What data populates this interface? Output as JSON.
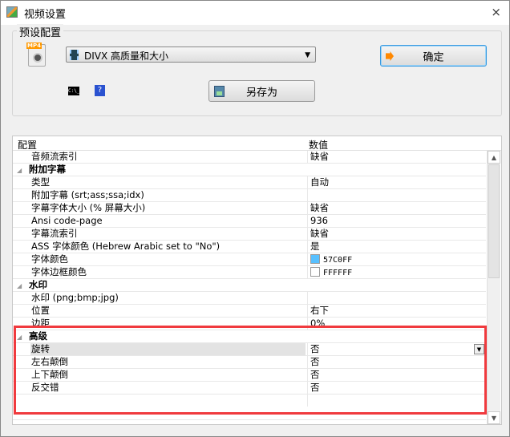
{
  "window": {
    "title": "视频设置",
    "close": "×"
  },
  "preset": {
    "group_label": "预设配置",
    "file_icon_badge": "MP4",
    "selected_preset": "DIVX 高质量和大小",
    "ok_label": "确定",
    "save_as_label": "另存为",
    "cmd_icon_text": "C:\\_",
    "help_icon_text": "?"
  },
  "grid": {
    "col_name": "配置",
    "col_value": "数值",
    "rows": [
      {
        "type": "prop",
        "name": "音频流索引",
        "value": "缺省"
      },
      {
        "type": "cat",
        "name": "附加字幕"
      },
      {
        "type": "prop",
        "name": "类型",
        "value": "自动"
      },
      {
        "type": "prop",
        "name": "附加字幕 (srt;ass;ssa;idx)",
        "value": ""
      },
      {
        "type": "prop",
        "name": "字幕字体大小 (% 屏幕大小)",
        "value": "缺省"
      },
      {
        "type": "prop",
        "name": "Ansi code-page",
        "value": "936"
      },
      {
        "type": "prop",
        "name": "字幕流索引",
        "value": "缺省"
      },
      {
        "type": "prop",
        "name": "ASS 字体颜色 (Hebrew Arabic set to \"No\")",
        "value": "是"
      },
      {
        "type": "prop",
        "name": "字体颜色",
        "value": "57C0FF",
        "swatch": "#57C0FF"
      },
      {
        "type": "prop",
        "name": "字体边框颜色",
        "value": "FFFFFF",
        "swatch": "#FFFFFF"
      },
      {
        "type": "cat",
        "name": "水印"
      },
      {
        "type": "prop",
        "name": "水印 (png;bmp;jpg)",
        "value": ""
      },
      {
        "type": "prop",
        "name": "位置",
        "value": "右下"
      },
      {
        "type": "prop",
        "name": "边距",
        "value": "0%"
      },
      {
        "type": "cat",
        "name": "高级"
      },
      {
        "type": "prop",
        "name": "旋转",
        "value": "否",
        "selected": true
      },
      {
        "type": "prop",
        "name": "左右颠倒",
        "value": "否"
      },
      {
        "type": "prop",
        "name": "上下颠倒",
        "value": "否"
      },
      {
        "type": "prop",
        "name": "反交错",
        "value": "否"
      },
      {
        "type": "empty"
      }
    ]
  },
  "highlight_color": "#F03A3E"
}
